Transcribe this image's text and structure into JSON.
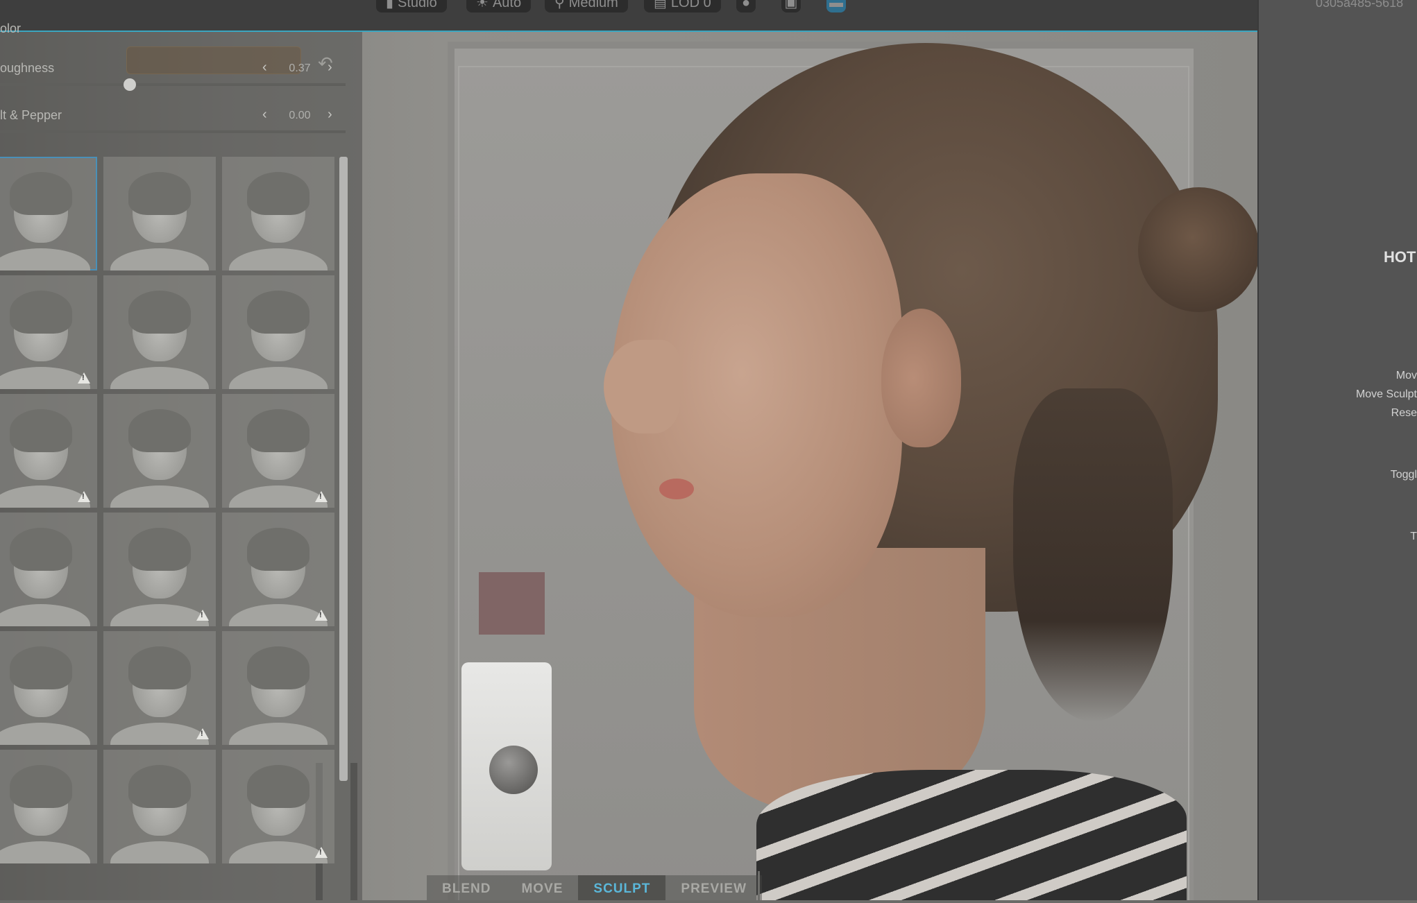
{
  "toolbar": {
    "items": [
      {
        "icon": "camera-icon",
        "label": "Studio"
      },
      {
        "icon": "sun-icon",
        "label": "Auto"
      },
      {
        "icon": "pin-icon",
        "label": "Medium"
      },
      {
        "icon": "layers-icon",
        "label": "LOD 0"
      }
    ]
  },
  "left_panel": {
    "color_label": "olor",
    "roughness": {
      "label": "oughness",
      "value": "0.37",
      "fraction": 0.37
    },
    "salt_pepper": {
      "label": "lt & Pepper",
      "value": "0.00",
      "fraction": 0.0
    },
    "hair_presets": [
      {
        "warning": false,
        "selected": true
      },
      {
        "warning": false,
        "selected": false
      },
      {
        "warning": false,
        "selected": false
      },
      {
        "warning": true,
        "selected": false
      },
      {
        "warning": false,
        "selected": false
      },
      {
        "warning": false,
        "selected": false
      },
      {
        "warning": true,
        "selected": false
      },
      {
        "warning": false,
        "selected": false
      },
      {
        "warning": true,
        "selected": false
      },
      {
        "warning": false,
        "selected": false
      },
      {
        "warning": true,
        "selected": false
      },
      {
        "warning": true,
        "selected": false
      },
      {
        "warning": false,
        "selected": false
      },
      {
        "warning": true,
        "selected": false
      },
      {
        "warning": false,
        "selected": false
      },
      {
        "warning": false,
        "selected": false
      },
      {
        "warning": false,
        "selected": false
      },
      {
        "warning": true,
        "selected": false
      }
    ]
  },
  "mode_tabs": [
    {
      "label": "BLEND",
      "active": false
    },
    {
      "label": "MOVE",
      "active": false
    },
    {
      "label": "SCULPT",
      "active": true
    },
    {
      "label": "PREVIEW",
      "active": false
    }
  ],
  "right_panel": {
    "id_text": "0305a485-5618",
    "hotkeys_title": "HOT",
    "hotkeys": [
      "Mov",
      "Move Sculpt",
      "Rese",
      "Toggl",
      "T"
    ]
  },
  "colors": {
    "accent": "#5bb7d9",
    "border_accent": "#3aa6c0"
  }
}
